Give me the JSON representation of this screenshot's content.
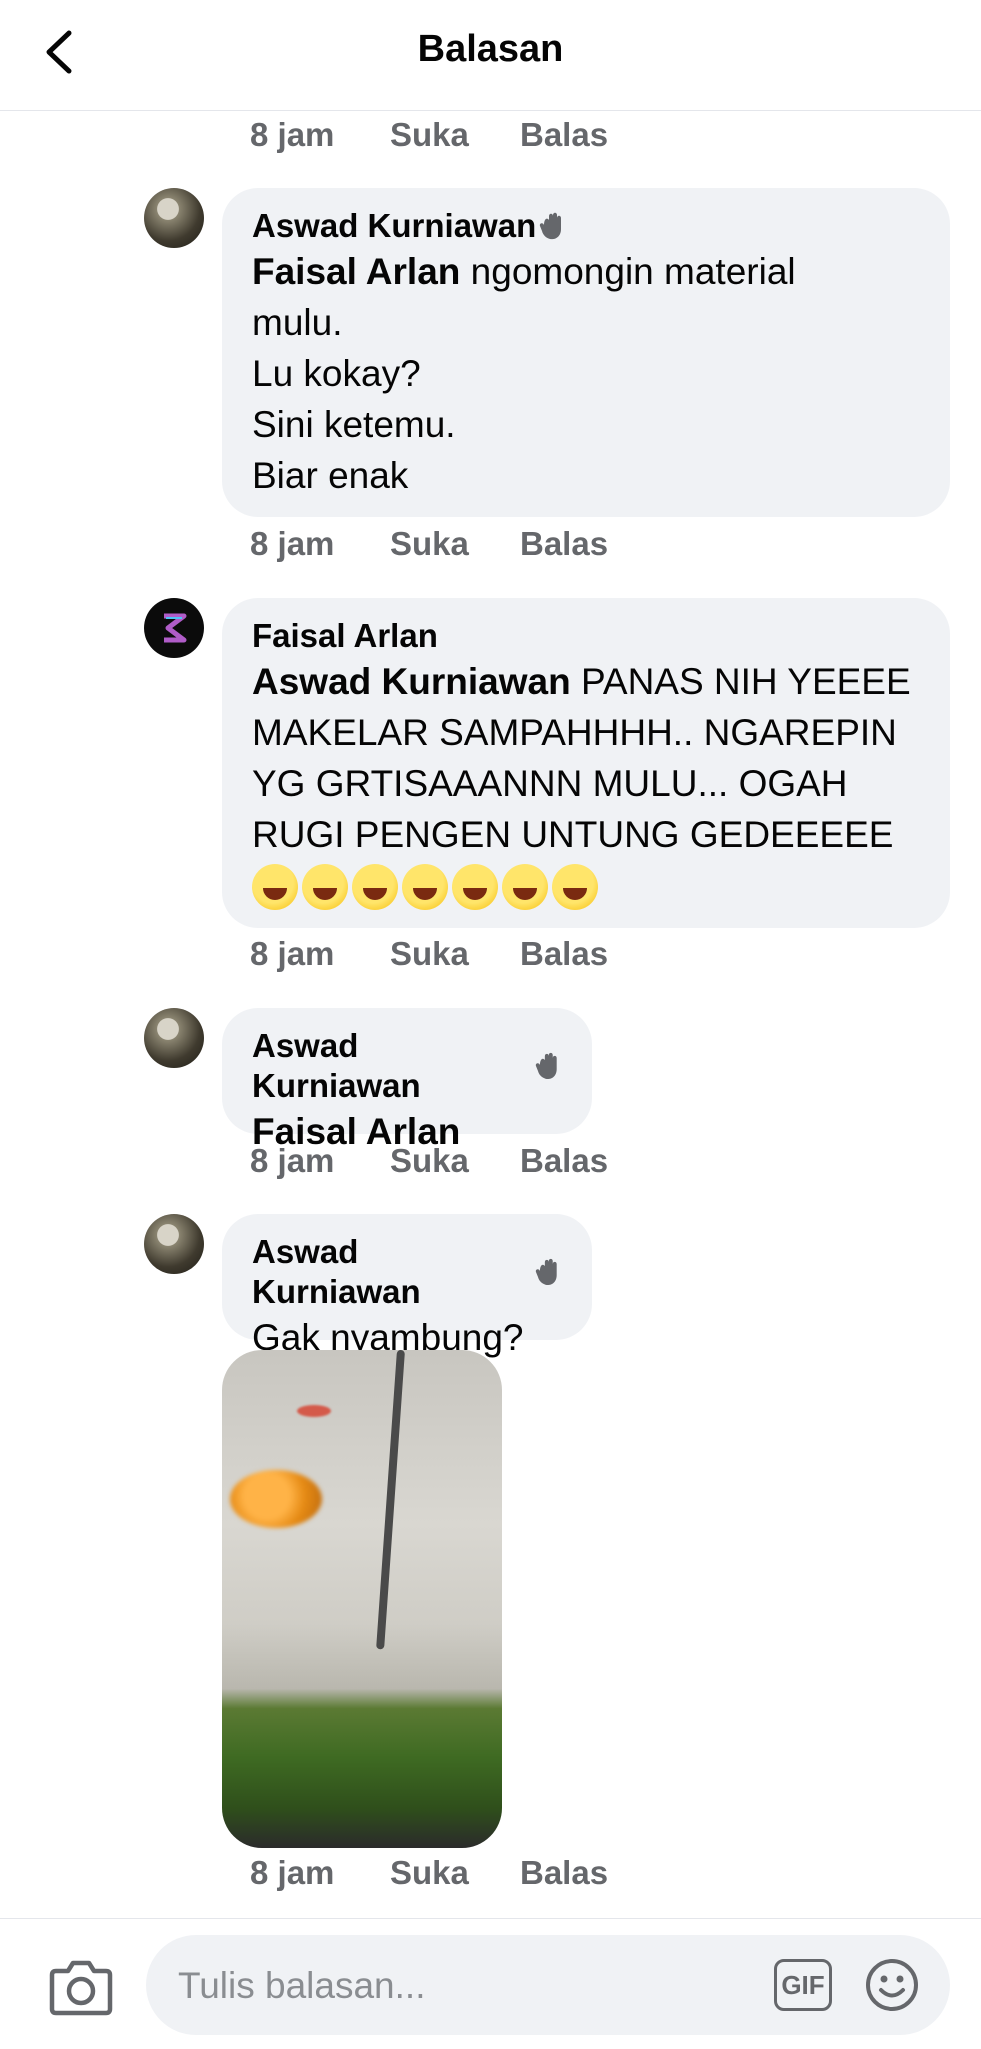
{
  "header": {
    "title": "Balasan"
  },
  "comments": [
    {
      "actions": {
        "time": "8 jam",
        "like": "Suka",
        "reply": "Balas"
      }
    },
    {
      "author": "Aswad Kurniawan",
      "mention": "Faisal Arlan",
      "text": " ngomongin material\nmulu.\nLu kokay?\nSini ketemu.\nBiar enak",
      "actions": {
        "time": "8 jam",
        "like": "Suka",
        "reply": "Balas"
      }
    },
    {
      "author": "Faisal Arlan",
      "mention": "Aswad Kurniawan",
      "text": " PANAS NIH YEEEE\nMAKELAR SAMPAHHHH.. NGAREPIN\nYG GRTISAAANNN MULU... OGAH\nRUGI PENGEN UNTUNG GEDEEEEE",
      "emoji_icons": [
        "rolling-laughing",
        "tears-of-joy",
        "grinning-sweat",
        "grinning-sweat",
        "grinning-sweat",
        "rolling-laughing",
        "tears-of-joy"
      ],
      "actions": {
        "time": "8 jam",
        "like": "Suka",
        "reply": "Balas"
      }
    },
    {
      "author": "Aswad Kurniawan",
      "mention": "Faisal Arlan",
      "actions": {
        "time": "8 jam",
        "like": "Suka",
        "reply": "Balas"
      }
    },
    {
      "author": "Aswad Kurniawan",
      "text": "Gak nyambung?",
      "attachment_icon": "aquarium-photo",
      "actions": {
        "time": "8 jam",
        "like": "Suka",
        "reply": "Balas"
      }
    }
  ],
  "composer": {
    "placeholder": "Tulis balasan...",
    "gif_label": "GIF",
    "camera_icon": "camera-icon",
    "emoji_icon": "smiley-icon"
  },
  "colors": {
    "bubble": "#f0f2f5",
    "secondary_text": "#65676b",
    "primary_text": "#050505"
  }
}
